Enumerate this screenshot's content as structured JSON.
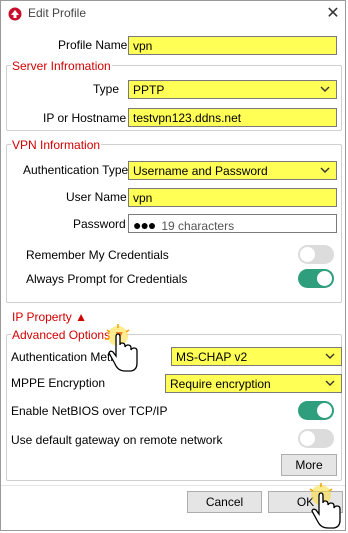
{
  "window": {
    "title": "Edit Profile",
    "close_glyph": "✕"
  },
  "profile": {
    "label": "Profile Name",
    "value": "vpn"
  },
  "server": {
    "section_title": "Server Infromation",
    "type_label": "Type",
    "type_value": "PPTP",
    "host_label": "IP or Hostname",
    "host_value": "testvpn123.ddns.net"
  },
  "vpn": {
    "section_title": "VPN Information",
    "auth_label": "Authentication Type",
    "auth_value": "Username and Password",
    "user_label": "User Name",
    "user_value": "vpn",
    "password_label": "Password",
    "password_dots": "●●●",
    "password_hint": "19 characters",
    "remember_label": "Remember My Credentials",
    "remember_on": false,
    "prompt_label": "Always Prompt for Credentials",
    "prompt_on": true
  },
  "ip_property": {
    "label": "IP Property",
    "arrow": "▲"
  },
  "advanced": {
    "label": "Advanced Options",
    "arrow": "▼",
    "auth_method_label": "Authentication Metho",
    "auth_method_value": "MS-CHAP v2",
    "mppe_label": "MPPE Encryption",
    "mppe_value": "Require encryption",
    "netbios_label": "Enable NetBIOS over TCP/IP",
    "netbios_on": true,
    "gateway_label": "Use default gateway on remote network",
    "gateway_on": false,
    "more_label": "More"
  },
  "footer": {
    "cancel_label": "Cancel",
    "ok_label": "OK"
  },
  "colors": {
    "highlight": "#ffff55",
    "section_title": "#d40000",
    "toggle_on": "#2e9e7d",
    "toggle_off": "#dcdcdc"
  },
  "icons": [
    "app-icon",
    "close-icon",
    "chevron-down-icon",
    "hand-cursor-icon"
  ]
}
